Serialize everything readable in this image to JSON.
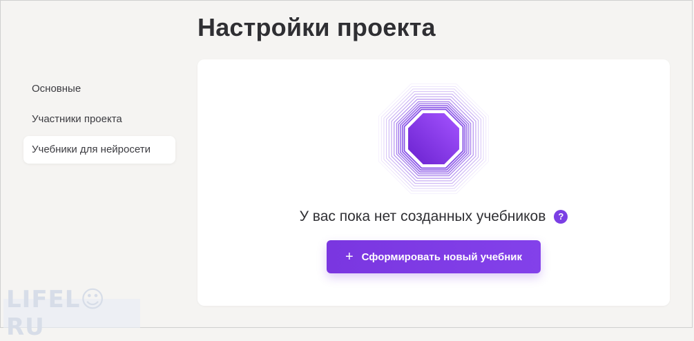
{
  "header": {
    "title": "Настройки проекта"
  },
  "sidebar": {
    "items": [
      {
        "label": "Основные",
        "active": false
      },
      {
        "label": "Участники проекта",
        "active": false
      },
      {
        "label": "Учебники для нейросети",
        "active": true
      }
    ]
  },
  "main": {
    "empty_state": {
      "illustration_icon": "concentric-octagon-icon",
      "message": "У вас пока нет созданных учебников",
      "help_icon": "question-icon",
      "help_symbol": "?"
    },
    "create_button": {
      "icon": "plus-icon",
      "icon_symbol": "+",
      "label": "Сформировать новый учебник"
    }
  },
  "watermark": {
    "text": "LIFEL☺RU"
  },
  "colors": {
    "accent": "#7b3fe4",
    "background": "#f5f4f2",
    "card": "#ffffff",
    "text": "#2f2f33"
  }
}
